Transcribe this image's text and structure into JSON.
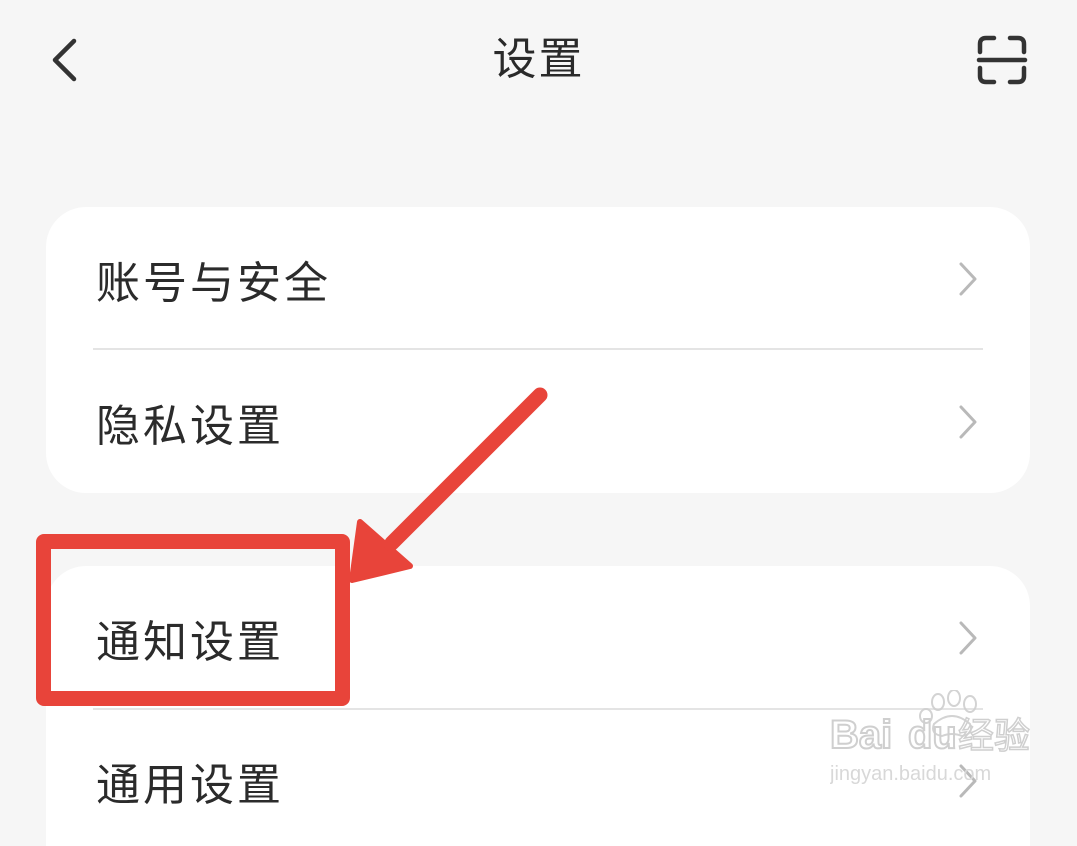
{
  "header": {
    "title": "设置",
    "back_icon": "chevron-left-icon",
    "scan_icon": "scan-icon"
  },
  "groups": [
    {
      "items": [
        {
          "label": "账号与安全",
          "icon": "chevron-right-icon"
        },
        {
          "label": "隐私设置",
          "icon": "chevron-right-icon"
        }
      ]
    },
    {
      "items": [
        {
          "label": "通知设置",
          "icon": "chevron-right-icon"
        },
        {
          "label": "通用设置",
          "icon": "chevron-right-icon"
        }
      ]
    }
  ],
  "annotation": {
    "color": "#e8443a",
    "highlighted_item": "通知设置"
  },
  "watermark": {
    "brand": "Bai du 经验",
    "url": "jingyan.baidu.com"
  },
  "colors": {
    "background": "#f6f6f6",
    "card": "#ffffff",
    "text": "#2b2b2b",
    "chevron": "#b9b9b9",
    "divider": "#e4e4e4"
  }
}
